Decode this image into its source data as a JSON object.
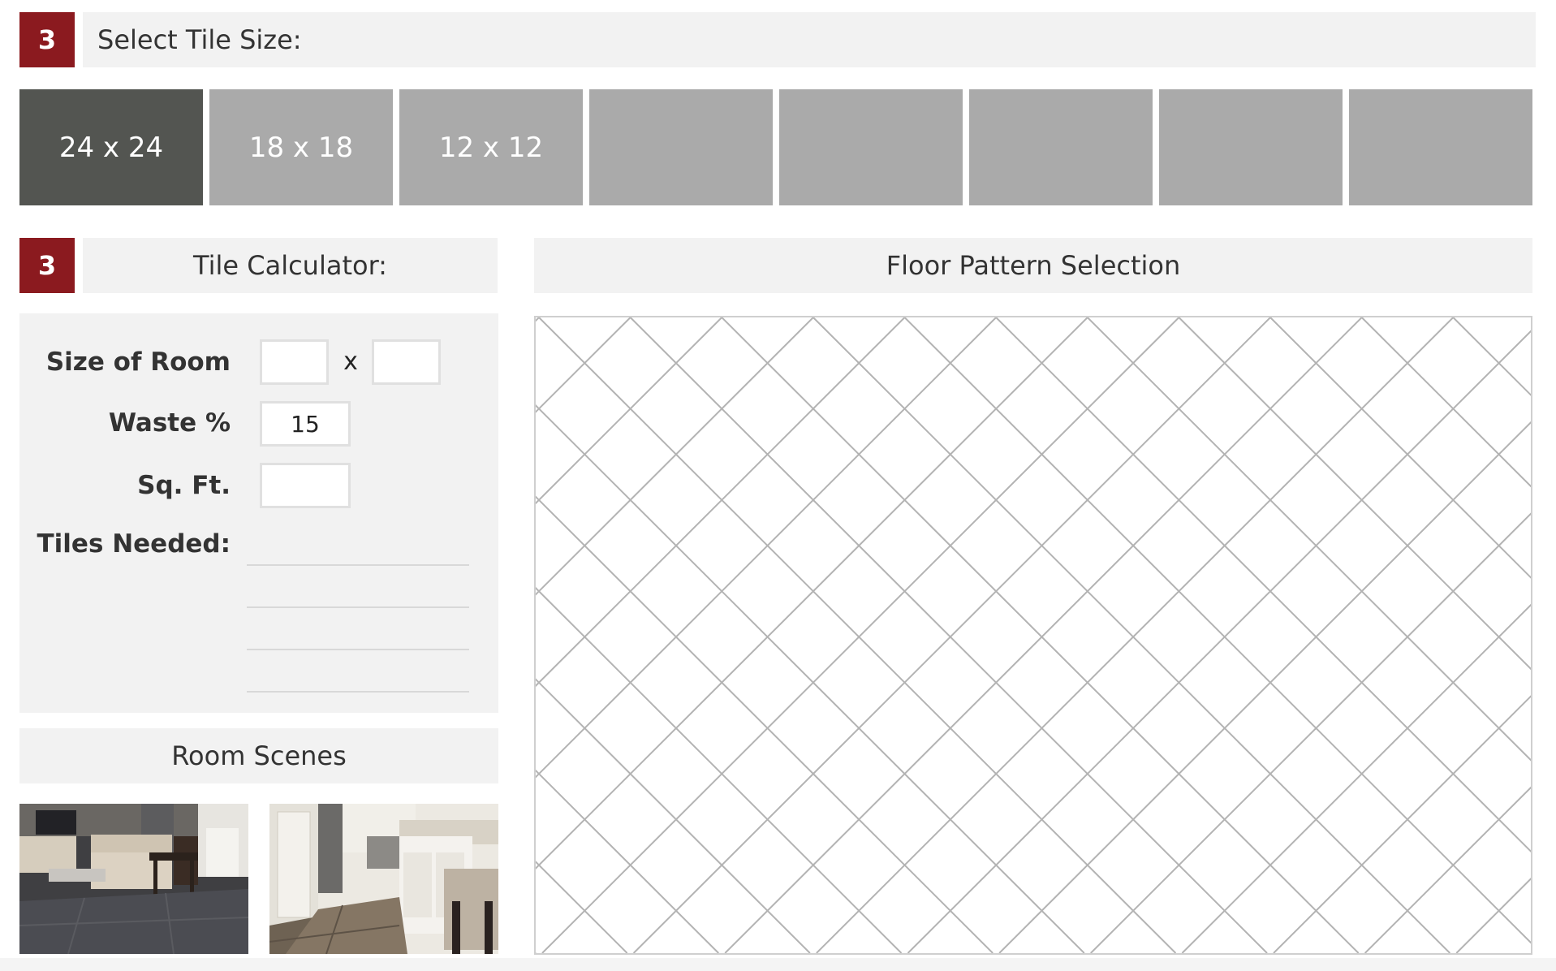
{
  "step_tile_size": {
    "badge": "3",
    "title": "Select Tile Size:"
  },
  "tile_sizes": [
    {
      "label": "24 x 24",
      "selected": true
    },
    {
      "label": "18 x 18",
      "selected": false
    },
    {
      "label": "12 x 12",
      "selected": false
    },
    {
      "label": "",
      "selected": false
    },
    {
      "label": "",
      "selected": false
    },
    {
      "label": "",
      "selected": false
    },
    {
      "label": "",
      "selected": false
    },
    {
      "label": "",
      "selected": false
    }
  ],
  "step_calculator": {
    "badge": "3",
    "title": "Tile Calculator:"
  },
  "floor_pattern": {
    "title": "Floor Pattern Selection",
    "pattern": "diagonal-diamond-grid"
  },
  "calculator": {
    "room_size_label": "Size of Room",
    "room_width_value": "",
    "room_length_value": "",
    "times_symbol": "x",
    "waste_label": "Waste %",
    "waste_value": "15",
    "sqft_label": "Sq. Ft.",
    "sqft_value": "",
    "tiles_needed_label": "Tiles Needed:"
  },
  "room_scenes": {
    "title": "Room Scenes"
  },
  "colors": {
    "badge": "#8b1a1f",
    "tile_active": "#535551",
    "tile_inactive": "#aaaaaa",
    "bar_bg": "#f2f2f2",
    "pattern_line": "#b3b3b3"
  }
}
